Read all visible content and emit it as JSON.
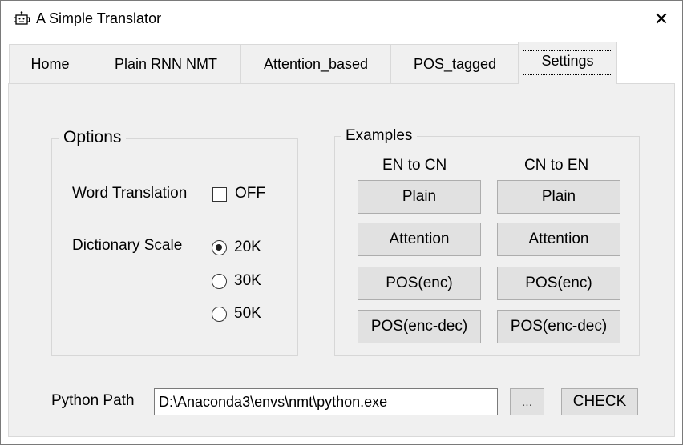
{
  "window": {
    "title": "A Simple Translator",
    "close_label": "✕"
  },
  "tabs": [
    {
      "label": "Home"
    },
    {
      "label": "Plain RNN NMT"
    },
    {
      "label": "Attention_based"
    },
    {
      "label": "POS_tagged"
    },
    {
      "label": "Settings",
      "active": true
    }
  ],
  "options": {
    "title": "Options",
    "word_translation_label": "Word Translation",
    "word_translation_toggle": "OFF",
    "word_translation_checked": false,
    "dictionary_scale_label": "Dictionary Scale",
    "scales": [
      {
        "label": "20K",
        "checked": true
      },
      {
        "label": "30K",
        "checked": false
      },
      {
        "label": "50K",
        "checked": false
      }
    ]
  },
  "examples": {
    "title": "Examples",
    "col1_header": "EN to CN",
    "col2_header": "CN to EN",
    "buttons": [
      "Plain",
      "Attention",
      "POS(enc)",
      "POS(enc-dec)"
    ]
  },
  "python_path": {
    "label": "Python Path",
    "value": "D:\\Anaconda3\\envs\\nmt\\python.exe",
    "browse_label": "...",
    "check_label": "CHECK"
  }
}
